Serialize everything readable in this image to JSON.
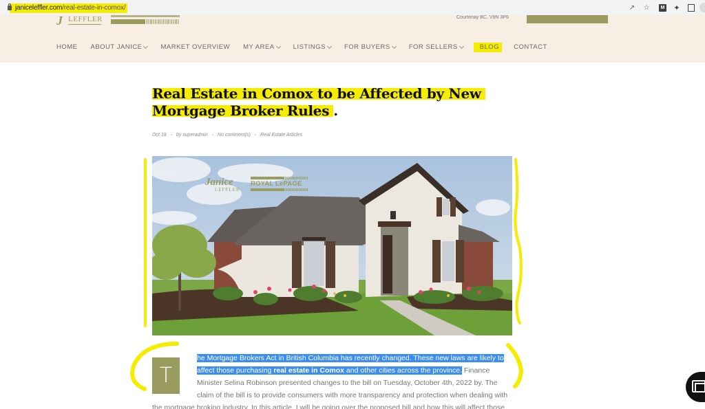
{
  "browser": {
    "url_domain": "janiceleffler.com",
    "url_path": "/real-estate-in-comox/",
    "toolbar_icons": [
      "share-icon",
      "bookmark-star-icon",
      "extension-m-icon",
      "extensions-puzzle-icon",
      "side-panel-icon",
      "profile-avatar-icon"
    ],
    "ext_m_label": "M"
  },
  "header": {
    "logo_leffler": "LEFFLER",
    "logo_initial": "J",
    "address": "Courtenay BC, V9N 3P6"
  },
  "nav": {
    "items": [
      {
        "label": "HOME",
        "dropdown": false
      },
      {
        "label": "ABOUT JANICE",
        "dropdown": true
      },
      {
        "label": "MARKET OVERVIEW",
        "dropdown": false
      },
      {
        "label": "MY AREA",
        "dropdown": true
      },
      {
        "label": "LISTINGS",
        "dropdown": true
      },
      {
        "label": "FOR BUYERS",
        "dropdown": true
      },
      {
        "label": "FOR SELLERS",
        "dropdown": true
      },
      {
        "label": "BLOG",
        "dropdown": false,
        "active": true
      },
      {
        "label": "CONTACT",
        "dropdown": false
      }
    ]
  },
  "article": {
    "title_line1": "Real Estate in Comox to be Affected by New",
    "title_line2": "Mortgage Broker Rules",
    "title_end": ".",
    "meta": {
      "date": "Oct 18",
      "author": "by superadmin",
      "comments": "No comment(s)",
      "category": "Real Estate Articles",
      "separator": "-"
    },
    "hero_image": {
      "alt": "White brick house with dark shingle roof and landscaped front yard",
      "logo_script": "Janice",
      "logo_sub": "LEFFLER",
      "logo_brand": "ROYAL LePAGE"
    },
    "dropcap": "T",
    "body": {
      "l1_sel": "he Mortgage Brokers Act in British Columbia has recently changed. These new laws are likely to",
      "l2_sel_a": "affect those purchasing ",
      "l2_sel_bold": "real estate in Comox",
      "l2_sel_b": " and other cities across the province.",
      "l2_rest": " Finance",
      "l3": "Minister Selina Robinson presented changes to the bill on Tuesday, October 4th, 2022 by. The",
      "l4": "claim of the bill is to provide consumers with more transparency and protection when dealing with",
      "l5": "the mortgage broking industry. In this article, I will be going over the proposed bill and how this will affect those"
    }
  },
  "colors": {
    "brand_olive": "#9a9b5f",
    "header_bg": "#f8eee3",
    "highlight_yellow": "#f5ec00",
    "selection_blue": "#3b8ef0"
  }
}
